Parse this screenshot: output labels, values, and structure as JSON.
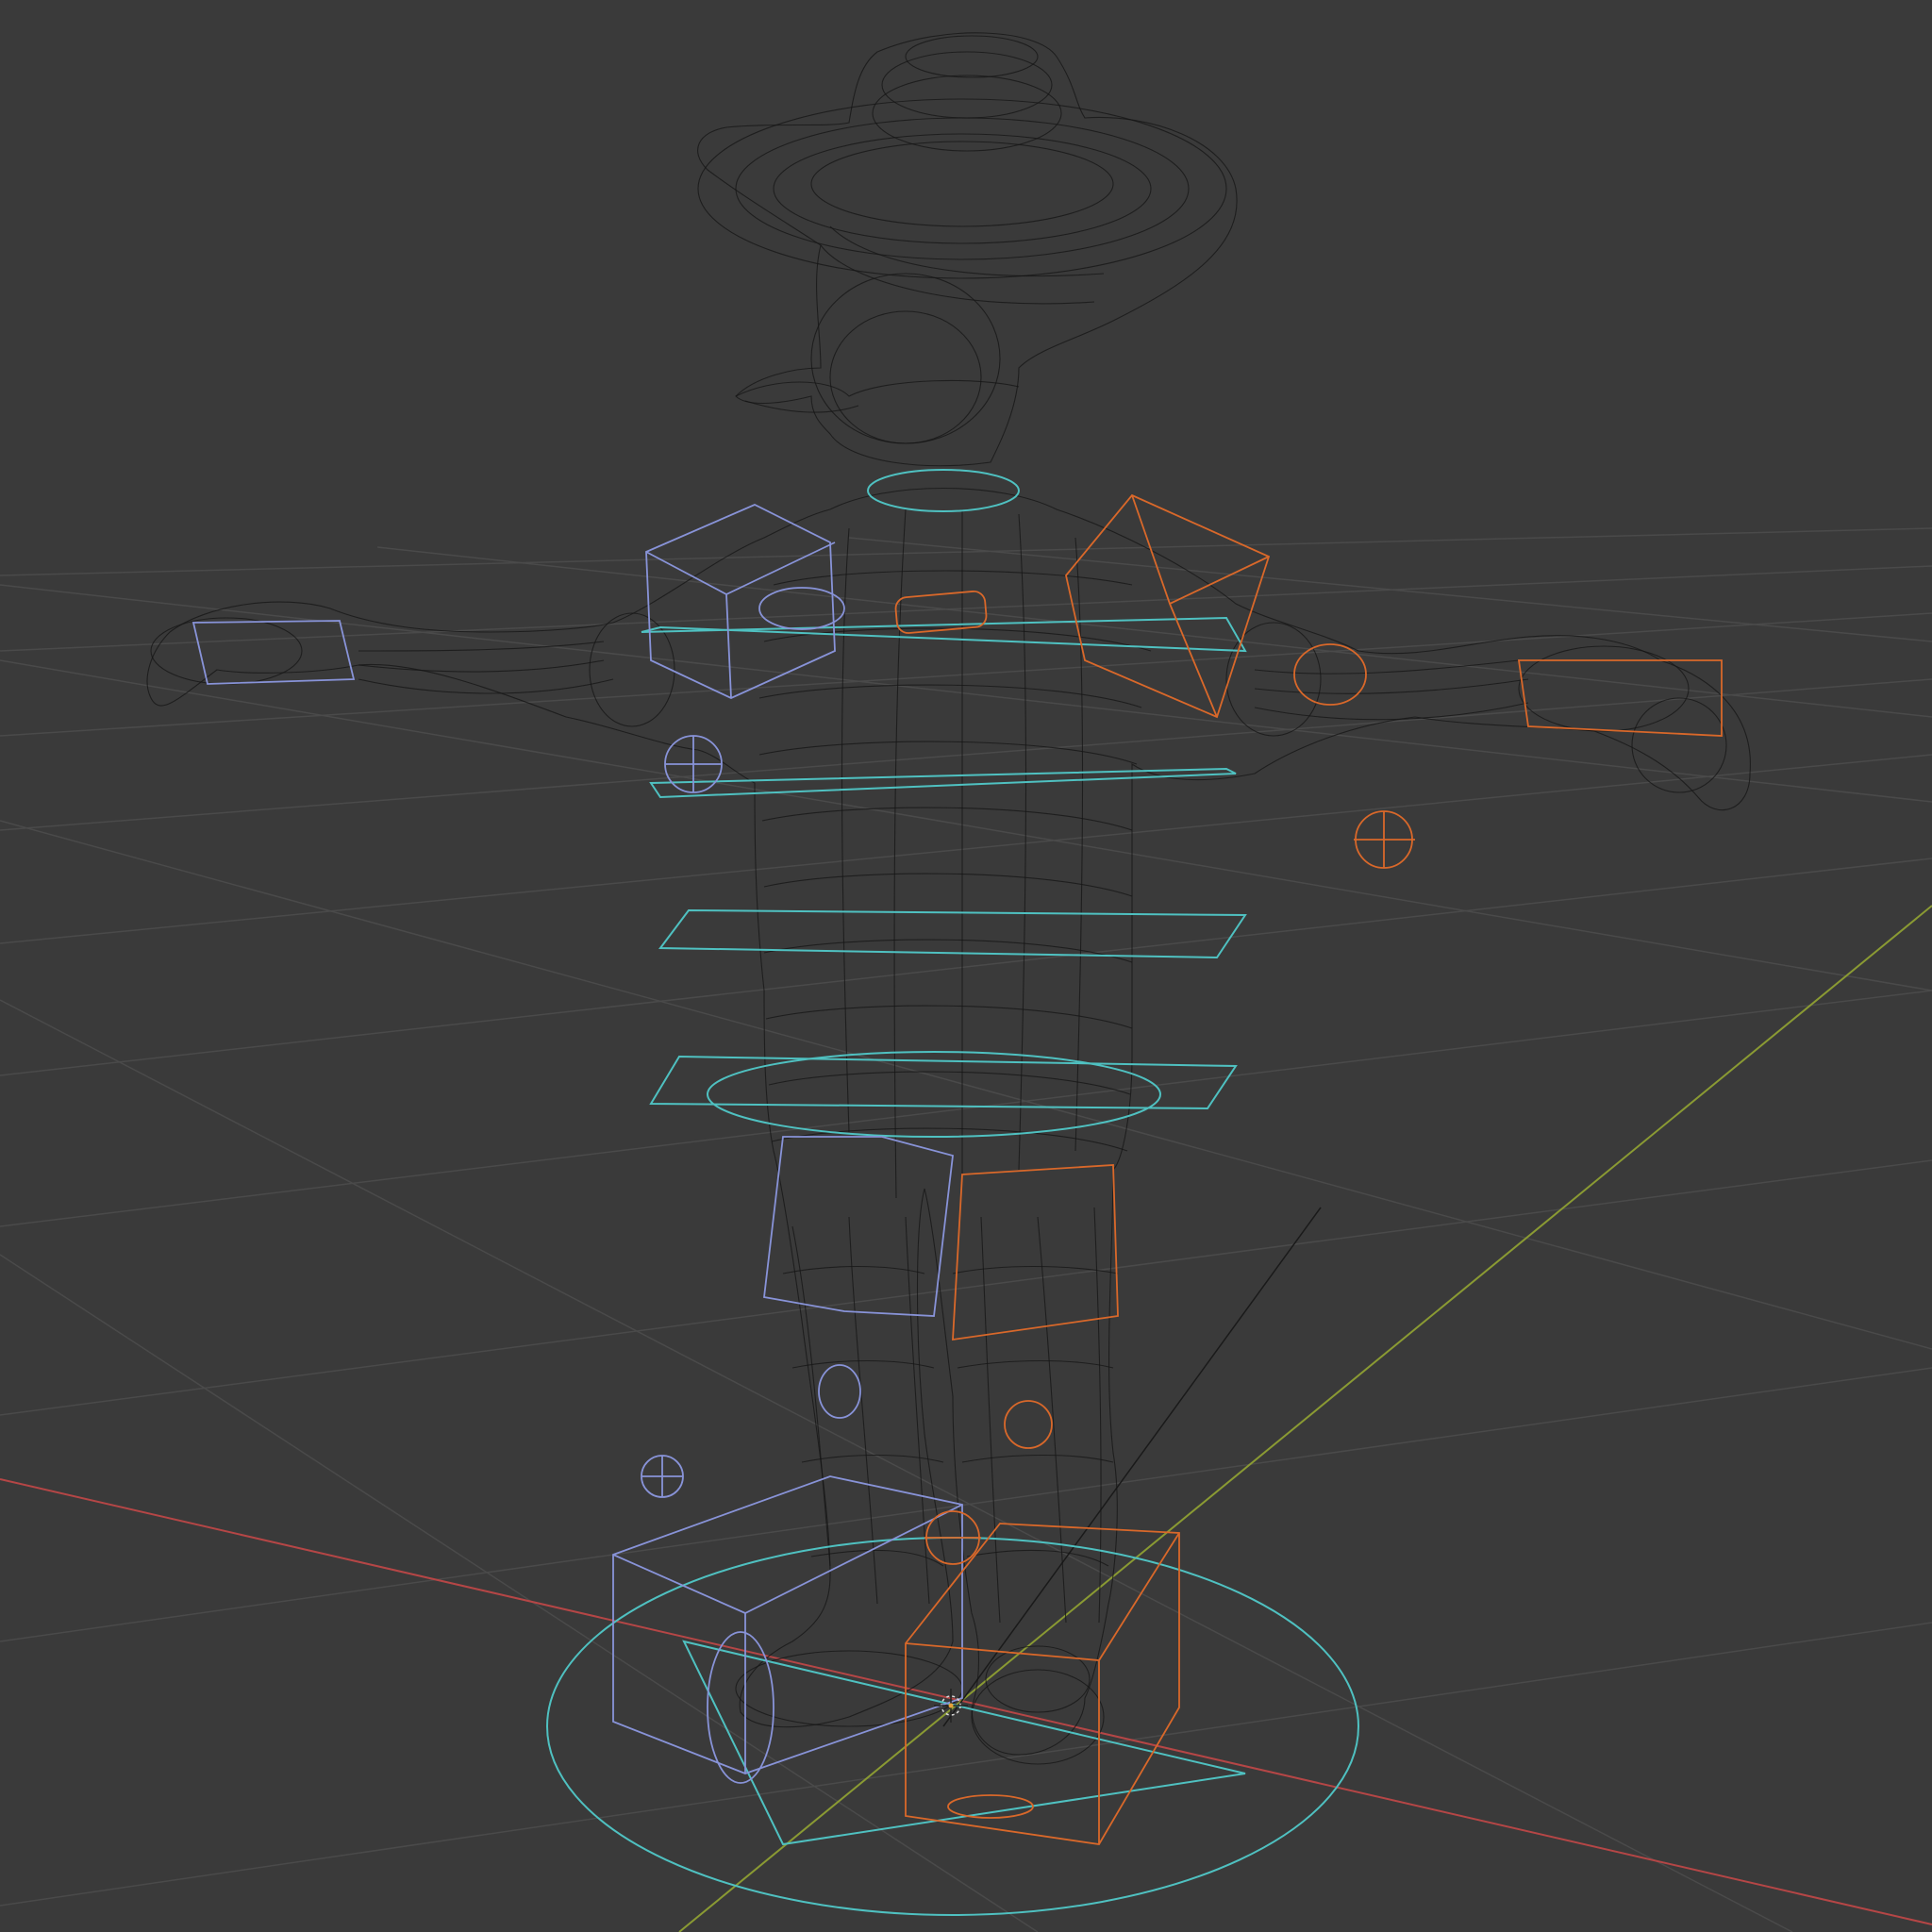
{
  "viewport": {
    "label": "",
    "colors": {
      "background": "#3a3a3a",
      "grid": "#4a4a4a",
      "x_axis": "#c04444",
      "y_axis": "#8a9a33",
      "mesh_wire": "#161616",
      "control_center": "#4fc1c1",
      "control_left": "#8893d8",
      "control_right": "#d9682a"
    },
    "objects": [
      {
        "name": "character-mesh",
        "kind": "wireframe"
      },
      {
        "name": "armature-controls-center",
        "color": "cyan"
      },
      {
        "name": "armature-controls-left",
        "color": "blue"
      },
      {
        "name": "armature-controls-right",
        "color": "orange"
      },
      {
        "name": "3d-cursor-icon",
        "kind": "cursor"
      }
    ]
  }
}
